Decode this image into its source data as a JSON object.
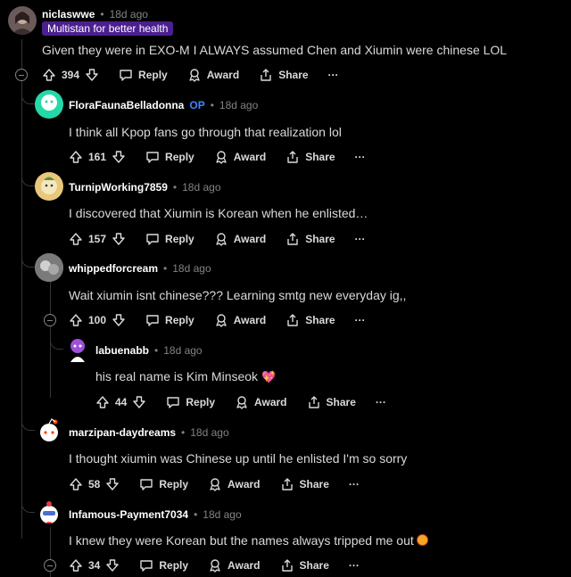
{
  "comments": [
    {
      "author": "niclaswwe",
      "op": "",
      "time": "18d ago",
      "flair": "Multistan for better health",
      "text": "Given they were in EXO-M I ALWAYS assumed Chen and Xiumin were chinese LOL",
      "votes": "394",
      "reply": "Reply",
      "award": "Award",
      "share": "Share",
      "avatar_color": "#6b5a5a"
    },
    {
      "author": "FloraFaunaBelladonna",
      "op": "OP",
      "time": "18d ago",
      "text": "I think all Kpop fans go through that realization lol",
      "votes": "161",
      "reply": "Reply",
      "award": "Award",
      "share": "Share",
      "avatar_color": "#24d9a8"
    },
    {
      "author": "TurnipWorking7859",
      "time": "18d ago",
      "text": "I discovered that Xiumin is Korean when he enlisted…",
      "votes": "157",
      "reply": "Reply",
      "award": "Award",
      "share": "Share",
      "avatar_color": "#e8c87a"
    },
    {
      "author": "whippedforcream",
      "time": "18d ago",
      "text": "Wait xiumin isnt chinese??? Learning smtg new everyday ig,,",
      "votes": "100",
      "reply": "Reply",
      "award": "Award",
      "share": "Share",
      "avatar_color": "#8c8c8c"
    },
    {
      "author": "labuenabb",
      "time": "18d ago",
      "text": "his real name is Kim Minseok",
      "heart": "💖",
      "votes": "44",
      "reply": "Reply",
      "award": "Award",
      "share": "Share",
      "avatar_color": "#a04fd9"
    },
    {
      "author": "marzipan-daydreams",
      "time": "18d ago",
      "text": "I thought xiumin was Chinese up until he enlisted I'm so sorry",
      "votes": "58",
      "reply": "Reply",
      "award": "Award",
      "share": "Share",
      "avatar_color": "#ff4500"
    },
    {
      "author": "Infamous-Payment7034",
      "time": "18d ago",
      "text": "I knew they were Korean but the names always tripped me out",
      "votes": "34",
      "reply": "Reply",
      "award": "Award",
      "share": "Share",
      "avatar_color": "#4a6fd1"
    }
  ],
  "more_label": "···",
  "colors": {
    "background": "#000000",
    "text": "#d7dadc",
    "meta": "#818384",
    "flair": "#4b1f8f",
    "op": "#3f86ff"
  }
}
